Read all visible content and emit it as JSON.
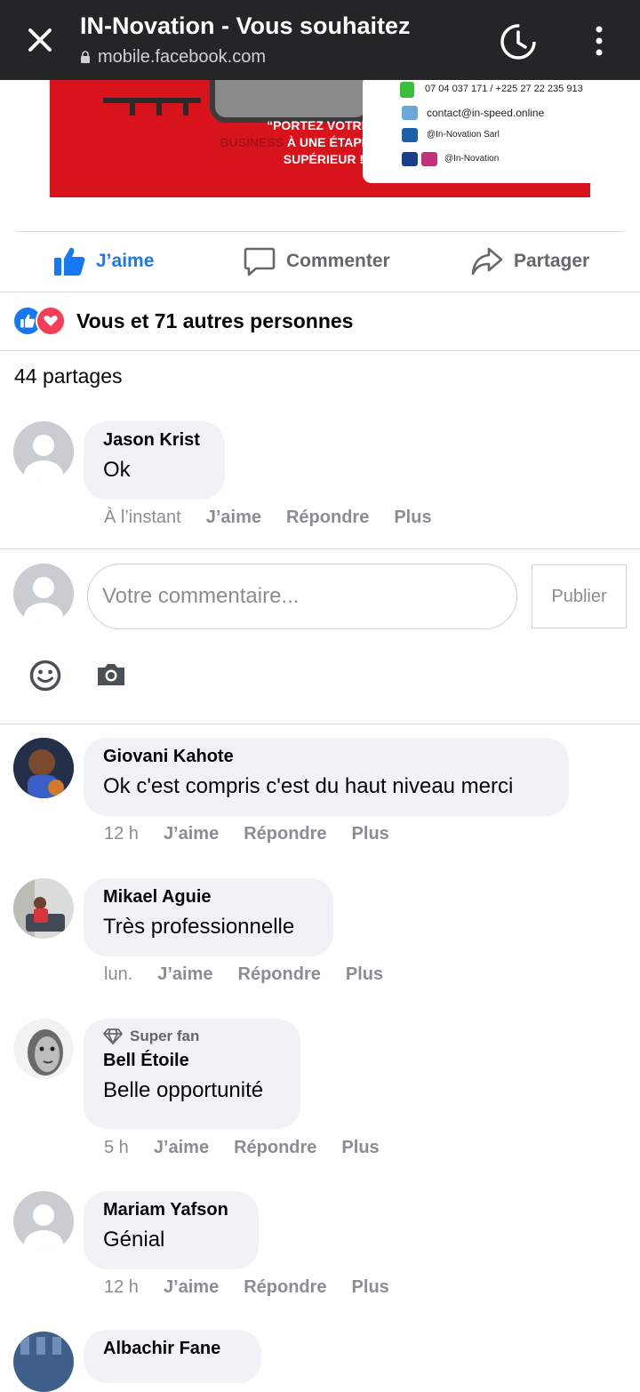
{
  "topbar": {
    "title": "IN-Novation - Vous souhaitez",
    "url": "mobile.facebook.com"
  },
  "banner": {
    "slogan_line1": "“PORTEZ VOTRE",
    "slogan_biz": "BUSINESS",
    "slogan_line2": " À UNE ÉTAPE",
    "slogan_line3": "SUPÉRIEUR !”",
    "phone": "07 04 037 171 / +225 27 22 235 913",
    "email": "contact@in-speed.online",
    "linkedin": "@In-Novation Sarl",
    "social": "@In-Novation"
  },
  "actions": {
    "like": "J’aime",
    "comment": "Commenter",
    "share": "Partager"
  },
  "reactions_text": "Vous et 71 autres personnes",
  "shares_text": "44 partages",
  "composer": {
    "placeholder": "Votre commentaire...",
    "publish": "Publier"
  },
  "comments": [
    {
      "name": "Jason Krist",
      "text": "Ok",
      "time": "À l’instant",
      "like": "J’aime",
      "reply": "Répondre",
      "more": "Plus"
    },
    {
      "name": "Giovani Kahote",
      "text": "Ok c'est compris c'est du haut niveau merci",
      "time": "12 h",
      "like": "J’aime",
      "reply": "Répondre",
      "more": "Plus"
    },
    {
      "name": "Mikael Aguie",
      "text": "Très professionnelle",
      "time": "lun.",
      "like": "J’aime",
      "reply": "Répondre",
      "more": "Plus"
    },
    {
      "badge": "Super fan",
      "name": "Bell Étoile",
      "text": "Belle opportunité",
      "time": "5 h",
      "like": "J’aime",
      "reply": "Répondre",
      "more": "Plus"
    },
    {
      "name": "Mariam Yafson",
      "text": "Génial",
      "time": "12 h",
      "like": "J’aime",
      "reply": "Répondre",
      "more": "Plus"
    },
    {
      "name": "Albachir Fane"
    }
  ],
  "colors": {
    "accent": "#1877f2",
    "love": "#f33e58",
    "topbar": "#242526",
    "banner_red": "#d7141b"
  }
}
